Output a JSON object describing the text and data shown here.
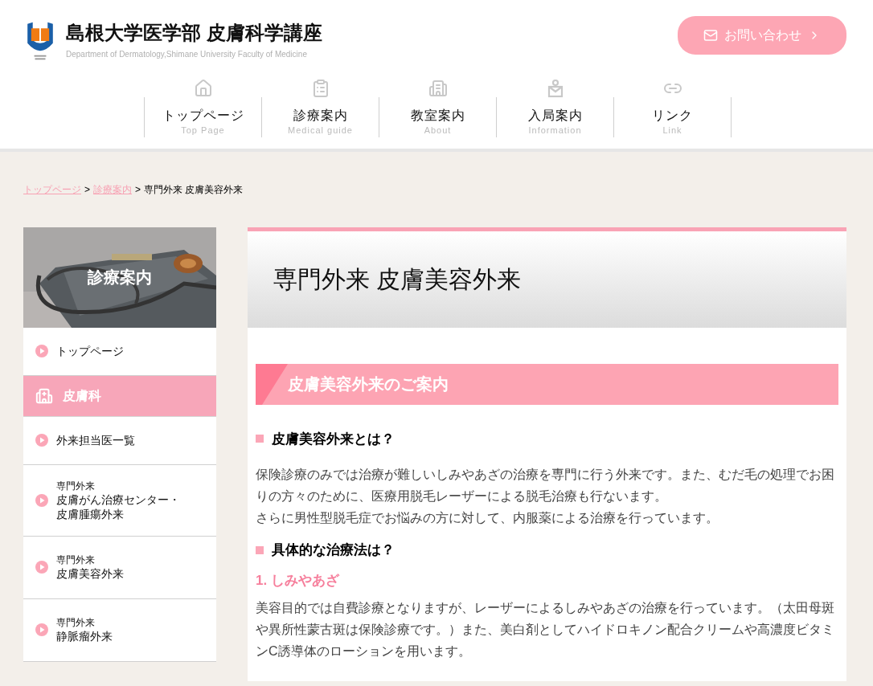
{
  "header": {
    "title": "島根大学医学部 皮膚科学講座",
    "subtitle": "Department of Dermatology,Shimane University Faculty of Medicine",
    "contact_button": "お問い合わせ"
  },
  "nav": [
    {
      "label": "トップページ",
      "sublabel": "Top Page"
    },
    {
      "label": "診療案内",
      "sublabel": "Medical guide"
    },
    {
      "label": "教室案内",
      "sublabel": "About"
    },
    {
      "label": "入局案内",
      "sublabel": "Information"
    },
    {
      "label": "リンク",
      "sublabel": "Link"
    }
  ],
  "breadcrumb": [
    {
      "kind": "link",
      "label": "トップページ"
    },
    {
      "kind": "separator",
      "label": ">"
    },
    {
      "kind": "link",
      "label": "診療案内"
    },
    {
      "kind": "separator",
      "label": ">"
    },
    {
      "kind": "current",
      "label": "専門外来 皮膚美容外来"
    }
  ],
  "sidebar": {
    "title": "診療案内",
    "items": [
      {
        "kind": "link",
        "label": "トップページ"
      },
      {
        "kind": "category",
        "label": "皮膚科"
      },
      {
        "kind": "link",
        "label": "外来担当医一覧"
      },
      {
        "kind": "link",
        "sublabel": "専門外来",
        "lines": [
          "皮膚がん治療センター・",
          "皮膚腫瘍外来"
        ]
      },
      {
        "kind": "link",
        "sublabel": "専門外来",
        "lines": [
          "皮膚美容外来"
        ]
      },
      {
        "kind": "link",
        "sublabel": "専門外来",
        "lines": [
          "静脈瘤外来"
        ]
      }
    ]
  },
  "page_title": "専門外来 皮膚美容外来",
  "section_title": "皮膚美容外来のご案内",
  "blocks": [
    {
      "kind": "heading",
      "text": "皮膚美容外来とは？"
    },
    {
      "kind": "paragraph",
      "text": "保険診療のみでは治療が難しいしみやあざの治療を専門に行う外来です。また、むだ毛の処理でお困りの方々のために、医療用脱毛レーザーによる脱毛治療も行ないます。"
    },
    {
      "kind": "paragraph",
      "text": "さらに男性型脱毛症でお悩みの方に対して、内服薬による治療を行っています。"
    },
    {
      "kind": "heading",
      "text": "具体的な治療法は？"
    },
    {
      "kind": "subheading",
      "text": "1. しみやあざ"
    },
    {
      "kind": "paragraph",
      "text": "美容目的では自費診療となりますが、レーザーによるしみやあざの治療を行っています。（太田母斑や異所性蒙古斑は保険診療です。）また、美白剤としてハイドロキノン配合クリームや高濃度ビタミンC誘導体のローションを用います。"
    }
  ]
}
